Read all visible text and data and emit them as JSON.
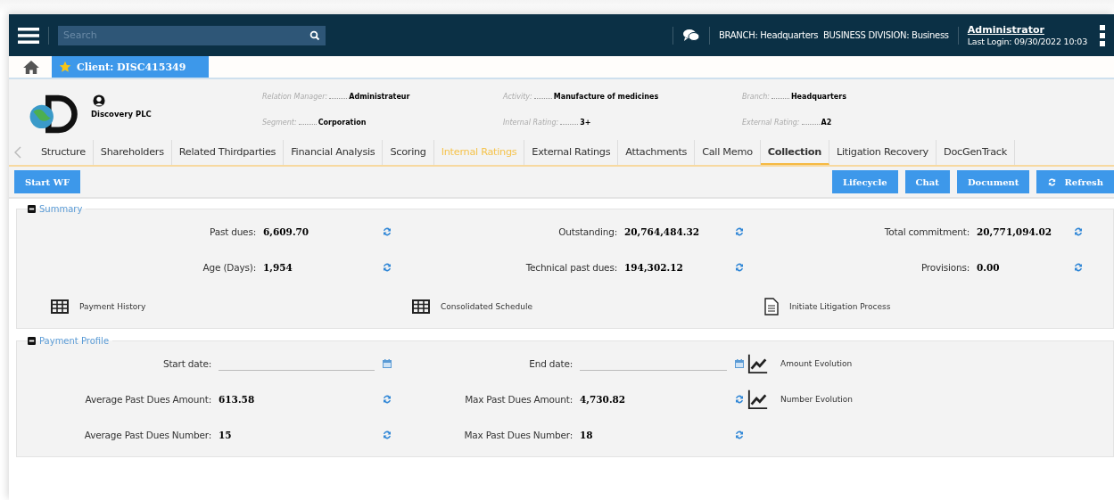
{
  "topbar": {
    "search": {
      "placeholder": "Search"
    },
    "context": "BRANCH: Headquarters  BUSINESS DIVISION: Business",
    "user": "Administrator",
    "last_login": "Last Login: 09/30/2022 10:03"
  },
  "doc_tabs": [
    {
      "label": "Client: DISC415349",
      "selected": true
    }
  ],
  "client": {
    "name": "Discovery PLC",
    "fields": [
      {
        "label": "Relation Manager:",
        "value": "Administrateur"
      },
      {
        "label": "Activity:",
        "value": "Manufacture of medicines"
      },
      {
        "label": "Branch:",
        "value": "Headquarters"
      },
      {
        "label": "Segment:",
        "value": "Corporation"
      },
      {
        "label": "Internal Rating:",
        "value": "3+"
      },
      {
        "label": "External Rating:",
        "value": "A2"
      }
    ]
  },
  "nav_tabs": [
    {
      "label": "Structure",
      "selected": false,
      "disabled": false
    },
    {
      "label": "Shareholders",
      "selected": false,
      "disabled": false
    },
    {
      "label": "Related Thirdparties",
      "selected": false,
      "disabled": false
    },
    {
      "label": "Financial Analysis",
      "selected": false,
      "disabled": false
    },
    {
      "label": "Scoring",
      "selected": false,
      "disabled": false
    },
    {
      "label": "Internal Ratings",
      "selected": false,
      "disabled": true
    },
    {
      "label": "External Ratings",
      "selected": false,
      "disabled": false
    },
    {
      "label": "Attachments",
      "selected": false,
      "disabled": false
    },
    {
      "label": "Call Memo",
      "selected": false,
      "disabled": false
    },
    {
      "label": "Collection",
      "selected": true,
      "disabled": false
    },
    {
      "label": "Litigation Recovery",
      "selected": false,
      "disabled": false
    },
    {
      "label": "DocGenTrack",
      "selected": false,
      "disabled": false
    }
  ],
  "toolbar": {
    "left": [
      "Start WF"
    ],
    "right": [
      {
        "label": "Lifecycle",
        "kind": "plain"
      },
      {
        "label": "Chat",
        "kind": "plain"
      },
      {
        "label": "Document",
        "kind": "plain"
      },
      {
        "label": "Refresh",
        "kind": "refresh"
      }
    ]
  },
  "summary": {
    "title": "Summary",
    "expanded": true,
    "metrics": [
      {
        "label": "Past dues:",
        "value": "6,609.70"
      },
      {
        "label": "Outstanding:",
        "value": "20,764,484.32"
      },
      {
        "label": "Total commitment:",
        "value": "20,771,094.02"
      },
      {
        "label": "Age (Days):",
        "value": "1,954"
      },
      {
        "label": "Technical past dues:",
        "value": "194,302.12"
      },
      {
        "label": "Provisions:",
        "value": "0.00"
      }
    ],
    "links": [
      {
        "label": "Payment History",
        "kind": "table"
      },
      {
        "label": "Consolidated Schedule",
        "kind": "table"
      },
      {
        "label": "Initiate Litigation Process",
        "kind": "document"
      }
    ]
  },
  "payment_profile": {
    "title": "Payment Profile",
    "expanded": true,
    "dates": [
      {
        "label": "Start date:"
      },
      {
        "label": "End date:"
      }
    ],
    "charts": [
      "Amount Evolution",
      "Number Evolution"
    ],
    "metrics": [
      {
        "label": "Average Past Dues Amount:",
        "value": "613.58"
      },
      {
        "label": "Max Past Dues Amount:",
        "value": "4,730.82"
      },
      {
        "label": "Average Past Dues Number:",
        "value": "15"
      },
      {
        "label": "Max Past Dues Number:",
        "value": "18"
      }
    ]
  }
}
